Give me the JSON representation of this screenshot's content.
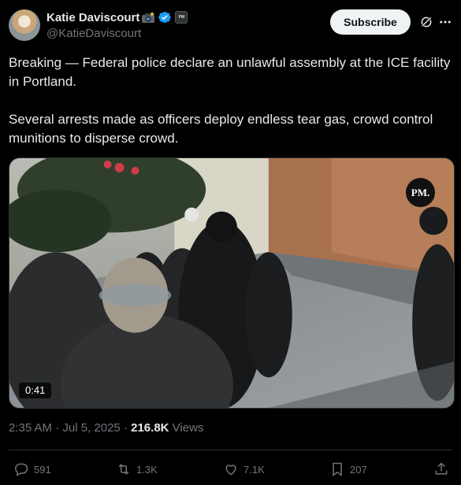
{
  "author": {
    "display_name": "Katie Daviscourt",
    "handle": "@KatieDaviscourt",
    "camera_emoji": "camera-flash-emoji",
    "verified_icon": "verified-badge-icon",
    "affiliate_label": "PM"
  },
  "header": {
    "subscribe_label": "Subscribe",
    "grok_icon": "grok-icon",
    "more_icon": "more-icon"
  },
  "post": {
    "paragraph_1": "Breaking — Federal police declare an unlawful assembly at the ICE facility in Portland.",
    "paragraph_2": "Several arrests made as officers deploy endless tear gas, crowd control munitions to disperse crowd."
  },
  "media": {
    "watermark": "PM.",
    "duration": "0:41"
  },
  "meta": {
    "time": "2:35 AM",
    "separator_1": "·",
    "date": "Jul 5, 2025",
    "separator_2": "·",
    "views_count": "216.8K",
    "views_label": "Views"
  },
  "actions": {
    "replies": "591",
    "reposts": "1.3K",
    "likes": "7.1K",
    "bookmarks": "207"
  },
  "colors": {
    "background": "#000000",
    "text_primary": "#e7e9ea",
    "text_secondary": "#71767b",
    "verified_blue": "#1d9bf0",
    "subscribe_bg": "#eff3f4"
  }
}
